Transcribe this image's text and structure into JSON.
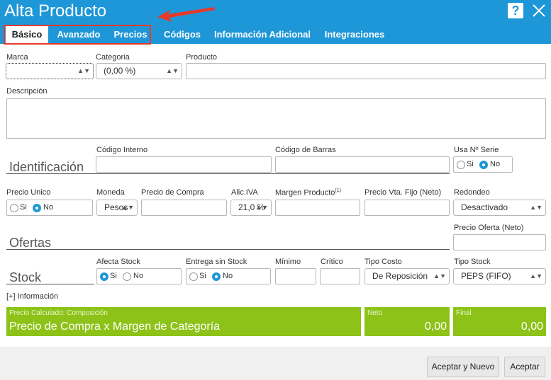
{
  "window": {
    "title": "Alta Producto",
    "help_label": "?"
  },
  "tabs": [
    {
      "label": "Básico"
    },
    {
      "label": "Avanzado"
    },
    {
      "label": "Precios"
    },
    {
      "label": "Códigos"
    },
    {
      "label": "Información Adicional"
    },
    {
      "label": "Integraciones"
    }
  ],
  "basic": {
    "marca_label": "Marca",
    "marca_value": "",
    "categoria_label": "Categoria",
    "categoria_value": "(0,00 %)",
    "producto_label": "Producto",
    "producto_value": "",
    "descripcion_label": "Descripción"
  },
  "identificacion": {
    "title": "Identificación",
    "codigo_interno_label": "Código Interno",
    "codigo_barras_label": "Código de Barras",
    "usa_serie_label": "Usa Nº Serie",
    "si_label": "Si",
    "no_label": "No",
    "selected": "No"
  },
  "precio": {
    "precio_unico_label": "Precio Unico",
    "si_label": "Si",
    "no_label": "No",
    "selected": "No",
    "moneda_label": "Moneda",
    "moneda_value": "Pesos",
    "precio_compra_label": "Precio de Compra",
    "alic_iva_label": "Alic.IVA",
    "alic_iva_value": "21,0 %",
    "margen_label": "Margen Producto",
    "margen_sup": "(1)",
    "precio_vta_label": "Precio Vta. Fijo (Neto)",
    "redondeo_label": "Redondeo",
    "redondeo_value": "Desactivado"
  },
  "ofertas": {
    "title": "Ofertas",
    "precio_oferta_label": "Precio Oferta (Neto)"
  },
  "stock": {
    "title": "Stock",
    "afecta_label": "Afecta Stock",
    "afecta_si": "Si",
    "afecta_no": "No",
    "afecta_selected": "Si",
    "entrega_label": "Entrega sin Stock",
    "entrega_si": "Si",
    "entrega_no": "No",
    "entrega_selected": "No",
    "minimo_label": "Mínimo",
    "critico_label": "Crítico",
    "tipo_costo_label": "Tipo Costo",
    "tipo_costo_value": "De Reposición",
    "tipo_stock_label": "Tipo Stock",
    "tipo_stock_value": "PEPS (FIFO)"
  },
  "info_link": "[+] Información",
  "composition": {
    "caption": "Precio Calculado: Composición",
    "formula": "Precio de Compra x Margen de Categoría",
    "neto_label": "Neto",
    "neto_value": "0,00",
    "final_label": "Final",
    "final_value": "0,00"
  },
  "footer": {
    "accept_new_label": "Aceptar y Nuevo",
    "accept_label": "Aceptar"
  },
  "colors": {
    "header": "#1e97d8",
    "highlight": "#e53a2a",
    "green": "#8dc218"
  }
}
